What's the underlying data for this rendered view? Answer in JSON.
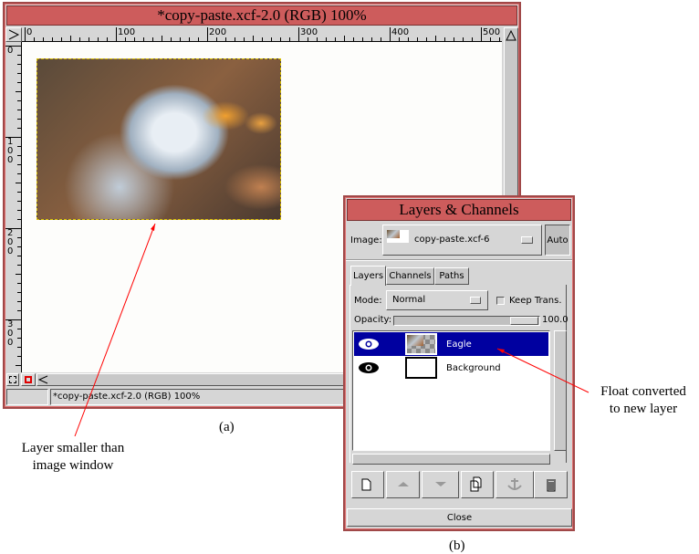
{
  "image_window": {
    "title": "*copy-paste.xcf-2.0 (RGB) 100%",
    "ruler_h_labels": [
      "0",
      "100",
      "200",
      "300",
      "400",
      "500"
    ],
    "ruler_v_labels": [
      "0",
      "100",
      "200",
      "300"
    ],
    "status_text": "*copy-paste.xcf-2.0 (RGB) 100%"
  },
  "layers_dialog": {
    "title": "Layers & Channels",
    "image_label": "Image:",
    "image_value": "copy-paste.xcf-6",
    "auto_button": "Auto",
    "tabs": [
      {
        "label": "Layers",
        "active": true
      },
      {
        "label": "Channels"
      },
      {
        "label": "Paths"
      }
    ],
    "mode_label": "Mode:",
    "mode_value": "Normal",
    "keep_trans_label": "Keep Trans.",
    "keep_trans_checked": false,
    "opacity_label": "Opacity:",
    "opacity_value": "100.0",
    "layers": [
      {
        "name": "Eagle",
        "selected": true,
        "visible": true
      },
      {
        "name": "Background",
        "selected": false,
        "visible": true
      }
    ],
    "close_button": "Close",
    "selection_color": "#0000a0"
  },
  "annotations": {
    "caption_a": "(a)",
    "caption_b": "(b)",
    "left_note": [
      "Layer smaller than",
      "image window"
    ],
    "right_note": [
      "Float converted",
      "to new layer"
    ],
    "arrow_color": "#ff0000"
  }
}
